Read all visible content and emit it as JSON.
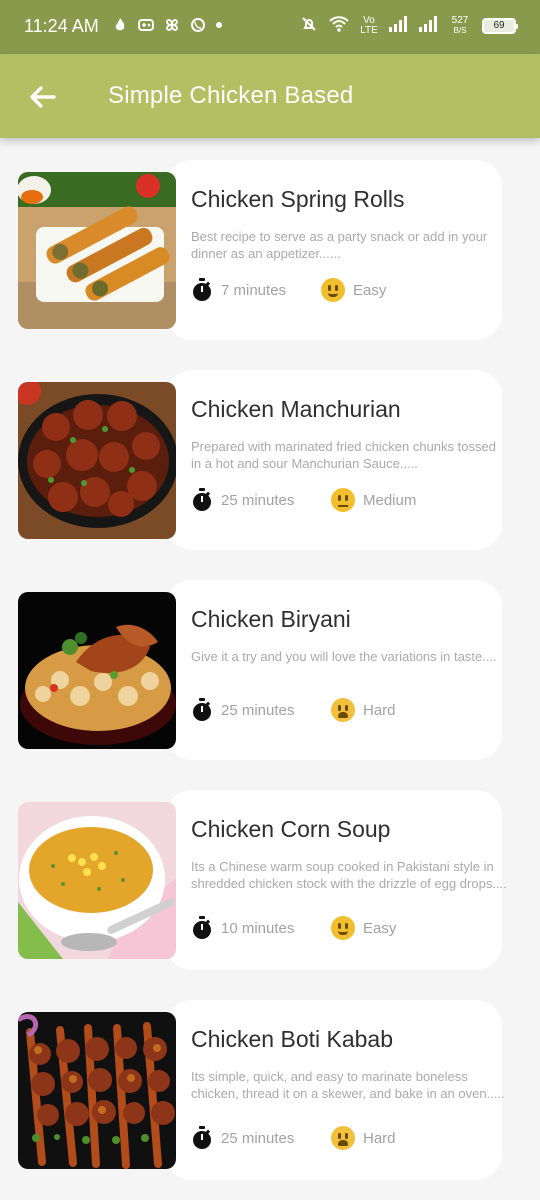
{
  "status": {
    "time": "11:24 AM",
    "network": "Vo LTE",
    "speed_value": "527",
    "speed_unit": "B/S",
    "battery": "69"
  },
  "header": {
    "title": "Simple Chicken Based"
  },
  "recipes": [
    {
      "title": "Chicken Spring Rolls",
      "description": "Best recipe to serve as a party snack or add in your dinner as an appetizer......",
      "time": "7 minutes",
      "difficulty": "Easy",
      "difficulty_icon": "slightly-smiling-face-icon"
    },
    {
      "title": "Chicken Manchurian",
      "description": "Prepared with marinated fried chicken chunks tossed in a hot and sour Manchurian Sauce.....",
      "time": "25 minutes",
      "difficulty": "Medium",
      "difficulty_icon": "neutral-face-icon"
    },
    {
      "title": "Chicken Biryani",
      "description": "Give it a try and you will love the variations in taste....",
      "time": "25 minutes",
      "difficulty": "Hard",
      "difficulty_icon": "anxious-face-icon"
    },
    {
      "title": "Chicken Corn Soup",
      "description": "Its a Chinese warm soup cooked in Pakistani style in shredded chicken stock with the drizzle of egg drops....",
      "time": "10 minutes",
      "difficulty": "Easy",
      "difficulty_icon": "slightly-smiling-face-icon"
    },
    {
      "title": "Chicken Boti Kabab",
      "description": "Its simple, quick, and easy to marinate boneless chicken, thread it on a skewer, and bake in an oven.....",
      "time": "25 minutes",
      "difficulty": "Hard",
      "difficulty_icon": "anxious-face-icon"
    }
  ],
  "colors": {
    "status_bar": "#8a9a4c",
    "app_bar": "#b2bf62",
    "background": "#f5f5f5",
    "card": "#ffffff"
  }
}
